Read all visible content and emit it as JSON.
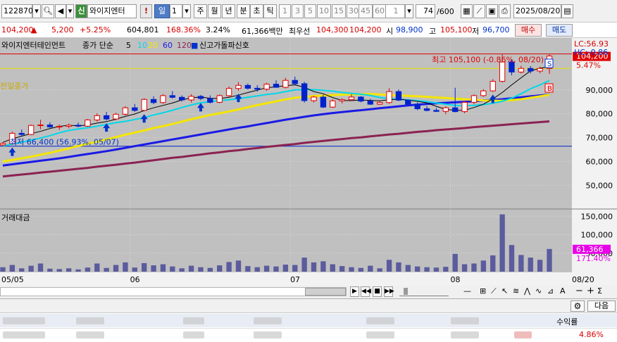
{
  "toolbar": {
    "code_value": "122870",
    "credit_label": "신",
    "name_value": "와이지엔터",
    "period_day": "일",
    "period_count": "1",
    "period_week": "주",
    "period_month": "월",
    "period_year": "년",
    "period_min": "분",
    "period_sec": "초",
    "period_tick": "틱",
    "intervals": [
      "1",
      "3",
      "5",
      "10",
      "15",
      "30",
      "45",
      "60"
    ],
    "interval_select": "1",
    "view_count": "74",
    "view_total": "/600",
    "date_value": "2025/08/20"
  },
  "quote": {
    "price": "104,200",
    "change": "5,200",
    "change_pct": "+5.25%",
    "volume": "604,801",
    "vol_ratio": "168.36%",
    "turnover": "3.24%",
    "trade_value": "61,366백만",
    "best_label": "최우선",
    "best_ask": "104,300",
    "best_bid": "104,200",
    "open_label": "시",
    "open": "98,900",
    "high_label": "고",
    "high": "105,100",
    "low_label": "저",
    "low": "96,700",
    "buy_button": "매수",
    "sell_button": "매도"
  },
  "legend": {
    "name": "와이지엔터테인먼트",
    "price_type": "종가 단순",
    "ma5": "5",
    "ma10": "10",
    "ma20": "20",
    "ma60": "60",
    "ma120": "120",
    "signal": "신고가돌파신호",
    "prev_close_label": "전일종가",
    "lc_label": "LC:56.93",
    "hc_label": "HC:-0.86",
    "volume_title": "거래대금"
  },
  "colors": {
    "up": "#d40000",
    "down": "#0033cc",
    "ma5": "#000000",
    "ma10": "#00d8e8",
    "ma20": "#f5e600",
    "ma60": "#1a1ae6",
    "ma120": "#8b2252",
    "volume": "#5b5b9e"
  },
  "chart_data": {
    "type": "candlestick",
    "x_tick_labels": [
      "05/05",
      "06",
      "07",
      "08",
      "08/20"
    ],
    "y_axis_price": [
      "90,000",
      "80,000",
      "70,000",
      "60,000",
      "50,000"
    ],
    "y_axis_volume": [
      "150,000",
      "100,000",
      "50,000"
    ],
    "ylim_price": [
      43000,
      110000
    ],
    "ylim_volume": [
      0,
      160000
    ],
    "current_price_label": "104,200",
    "current_pct_label": "5.47%",
    "volume_value_label": "61,366",
    "volume_pct_label": "171.40%",
    "high_annotation": "최고 105,100 (-0.86%, 08/20)",
    "low_annotation": "최저 66,400 (56.93%, 05/07)",
    "high_line": 105100,
    "low_line": 66400,
    "prev_close_line": 99000,
    "badges": [
      "S",
      "B"
    ],
    "candles": [
      [
        66900,
        68000,
        66400,
        67500
      ],
      [
        67500,
        72500,
        67000,
        71800
      ],
      [
        71800,
        73400,
        70800,
        71300
      ],
      [
        71300,
        75500,
        71000,
        75100
      ],
      [
        75100,
        77500,
        73500,
        75300
      ],
      [
        75300,
        76400,
        74100,
        74500
      ],
      [
        74500,
        75500,
        73200,
        74700
      ],
      [
        74700,
        75900,
        73900,
        75200
      ],
      [
        75200,
        76300,
        74300,
        74800
      ],
      [
        74800,
        77800,
        74500,
        77400
      ],
      [
        77400,
        80200,
        76700,
        79200
      ],
      [
        79200,
        80800,
        77200,
        77800
      ],
      [
        77800,
        80400,
        77300,
        79800
      ],
      [
        79800,
        83200,
        79300,
        82500
      ],
      [
        82500,
        84100,
        80800,
        81400
      ],
      [
        81400,
        86500,
        81000,
        86000
      ],
      [
        86000,
        87300,
        84000,
        84700
      ],
      [
        84700,
        88200,
        84200,
        87600
      ],
      [
        87600,
        89500,
        86400,
        86900
      ],
      [
        86900,
        87700,
        85100,
        85800
      ],
      [
        85800,
        88200,
        84700,
        87300
      ],
      [
        87300,
        87900,
        85700,
        86400
      ],
      [
        86400,
        87700,
        84300,
        84800
      ],
      [
        84800,
        88100,
        84400,
        87600
      ],
      [
        87600,
        91500,
        86900,
        90600
      ],
      [
        90600,
        93300,
        89600,
        91900
      ],
      [
        91900,
        92700,
        90100,
        90700
      ],
      [
        90700,
        92000,
        89300,
        90300
      ],
      [
        90300,
        93000,
        89600,
        92400
      ],
      [
        92400,
        94000,
        90900,
        91100
      ],
      [
        91100,
        95100,
        90600,
        94000
      ],
      [
        94000,
        95600,
        92200,
        92600
      ],
      [
        92600,
        93400,
        84700,
        85500
      ],
      [
        85500,
        87500,
        84700,
        87000
      ],
      [
        87000,
        88000,
        82400,
        82800
      ],
      [
        82800,
        86100,
        82400,
        85400
      ],
      [
        85400,
        86500,
        84300,
        85900
      ],
      [
        85900,
        88200,
        85400,
        87000
      ],
      [
        87000,
        87400,
        84800,
        85300
      ],
      [
        85300,
        86300,
        83700,
        84000
      ],
      [
        84000,
        85500,
        83700,
        84700
      ],
      [
        84700,
        90700,
        84200,
        89300
      ],
      [
        89300,
        90200,
        85300,
        85700
      ],
      [
        85700,
        86000,
        83100,
        84000
      ],
      [
        84000,
        84800,
        81500,
        82100
      ],
      [
        82100,
        83200,
        81000,
        81400
      ],
      [
        81400,
        82400,
        80700,
        81000
      ],
      [
        81000,
        83100,
        79800,
        82500
      ],
      [
        82500,
        90900,
        80600,
        80900
      ],
      [
        80900,
        85200,
        80200,
        84800
      ],
      [
        84800,
        88100,
        84000,
        87600
      ],
      [
        87600,
        90300,
        87100,
        89600
      ],
      [
        89600,
        94500,
        89200,
        93600
      ],
      [
        93600,
        105100,
        93100,
        101700
      ],
      [
        101700,
        102900,
        96100,
        97500
      ],
      [
        97500,
        100100,
        96900,
        99000
      ],
      [
        99000,
        100000,
        96900,
        97900
      ],
      [
        97900,
        99800,
        97000,
        99000
      ],
      [
        99000,
        105100,
        96700,
        104200
      ]
    ],
    "ma5": [
      68000,
      69500,
      70600,
      71700,
      72600,
      73800,
      74700,
      75200,
      74900,
      75300,
      76100,
      76700,
      77700,
      78900,
      79900,
      81300,
      82500,
      83500,
      84500,
      85800,
      86700,
      87000,
      86500,
      86400,
      86900,
      87800,
      88900,
      89900,
      90900,
      91300,
      91800,
      92100,
      91100,
      89300,
      88400,
      86800,
      85600,
      85500,
      85800,
      85600,
      85400,
      85900,
      86100,
      85700,
      85200,
      84600,
      83100,
      81900,
      81400,
      81500,
      82600,
      84000,
      86200,
      88900,
      92100,
      95100,
      98000,
      99100,
      99700
    ],
    "ma10": [
      66500,
      67300,
      68000,
      68900,
      69800,
      70800,
      72000,
      73000,
      73600,
      74100,
      74800,
      75500,
      76300,
      76800,
      77600,
      78400,
      79500,
      80400,
      81500,
      82600,
      83700,
      84600,
      85100,
      85500,
      85900,
      86300,
      86900,
      87500,
      88100,
      88500,
      89300,
      90000,
      90100,
      90100,
      89800,
      89500,
      88900,
      88500,
      88200,
      87700,
      86800,
      86400,
      86100,
      85800,
      85500,
      85100,
      84500,
      84000,
      83500,
      83300,
      83500,
      83800,
      84400,
      85200,
      86500,
      88400,
      90500,
      92100,
      93900
    ],
    "ma20": [
      60000,
      60600,
      61300,
      62000,
      62800,
      63600,
      64500,
      65500,
      66500,
      67400,
      68300,
      69200,
      70200,
      71200,
      72100,
      73000,
      74000,
      74800,
      75700,
      76700,
      77700,
      78600,
      79500,
      80200,
      81000,
      81800,
      82700,
      83600,
      84400,
      85200,
      86000,
      86700,
      87100,
      87400,
      87600,
      87800,
      88000,
      88100,
      88200,
      88300,
      88100,
      87900,
      87700,
      87500,
      87300,
      87100,
      86800,
      86600,
      86300,
      86100,
      85900,
      85600,
      85500,
      85400,
      85700,
      86100,
      86700,
      87300,
      88000
    ],
    "ma60": [
      58300,
      58800,
      59300,
      59800,
      60300,
      60800,
      61300,
      61900,
      62500,
      63100,
      63700,
      64300,
      65000,
      65700,
      66400,
      67100,
      67800,
      68500,
      69200,
      69900,
      70600,
      71300,
      72000,
      72700,
      73400,
      74100,
      74700,
      75400,
      76100,
      76800,
      77500,
      78100,
      78700,
      79300,
      79800,
      80300,
      80700,
      81100,
      81500,
      81900,
      82300,
      82700,
      83100,
      83500,
      83800,
      84100,
      84400,
      84600,
      84800,
      85000,
      85300,
      85600,
      85800,
      86100,
      86500,
      86900,
      87300,
      87700,
      88100
    ],
    "ma120": [
      53700,
      54100,
      54500,
      54900,
      55300,
      55700,
      56100,
      56500,
      56900,
      57300,
      57800,
      58200,
      58600,
      59100,
      59500,
      60000,
      60500,
      61000,
      61500,
      61900,
      62400,
      62900,
      63400,
      63800,
      64300,
      64700,
      65200,
      65600,
      66100,
      66500,
      66900,
      67300,
      67800,
      68200,
      68600,
      69000,
      69400,
      69800,
      70100,
      70500,
      70900,
      71300,
      71600,
      72000,
      72400,
      72700,
      73100,
      73400,
      73700,
      74000,
      74400,
      74700,
      75000,
      75300,
      75600,
      75900,
      76200,
      76500,
      76800
    ],
    "volume": [
      12000,
      18000,
      9000,
      16000,
      22000,
      8000,
      7000,
      9000,
      6000,
      11000,
      22000,
      10000,
      18000,
      25000,
      11000,
      23000,
      17000,
      20000,
      14000,
      9000,
      16000,
      12000,
      10000,
      17000,
      26000,
      30000,
      15000,
      12000,
      16000,
      14000,
      19000,
      18000,
      38000,
      25000,
      28000,
      20000,
      15000,
      12000,
      10000,
      16000,
      9000,
      32000,
      25000,
      18000,
      14000,
      12000,
      11000,
      13000,
      48000,
      20000,
      22000,
      30000,
      44000,
      155000,
      72000,
      45000,
      38000,
      32000,
      61366
    ]
  }
}
